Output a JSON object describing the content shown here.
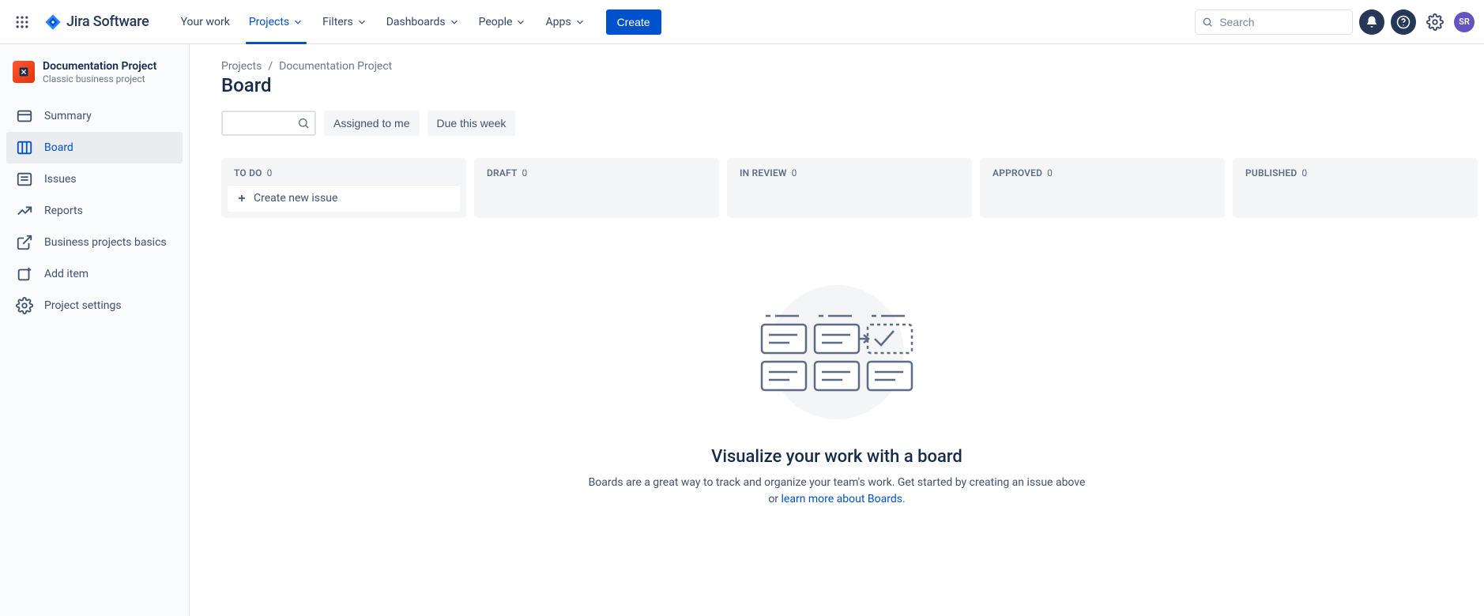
{
  "topnav": {
    "logo_text": "Jira Software",
    "items": [
      {
        "label": "Your work",
        "dropdown": false,
        "active": false
      },
      {
        "label": "Projects",
        "dropdown": true,
        "active": true
      },
      {
        "label": "Filters",
        "dropdown": true,
        "active": false
      },
      {
        "label": "Dashboards",
        "dropdown": true,
        "active": false
      },
      {
        "label": "People",
        "dropdown": true,
        "active": false
      },
      {
        "label": "Apps",
        "dropdown": true,
        "active": false
      }
    ],
    "create_label": "Create",
    "search_placeholder": "Search",
    "avatar_initials": "SR"
  },
  "sidebar": {
    "project_name": "Documentation Project",
    "project_type": "Classic business project",
    "items": [
      {
        "label": "Summary",
        "icon": "card"
      },
      {
        "label": "Board",
        "icon": "board",
        "active": true
      },
      {
        "label": "Issues",
        "icon": "issues"
      },
      {
        "label": "Reports",
        "icon": "reports"
      },
      {
        "label": "Business projects basics",
        "icon": "external"
      },
      {
        "label": "Add item",
        "icon": "add"
      },
      {
        "label": "Project settings",
        "icon": "gear"
      }
    ]
  },
  "main": {
    "breadcrumbs": [
      "Projects",
      "Documentation Project"
    ],
    "title": "Board",
    "filters": {
      "assigned_label": "Assigned to me",
      "due_label": "Due this week"
    },
    "columns": [
      {
        "name": "TO DO",
        "count": 0,
        "create": true
      },
      {
        "name": "DRAFT",
        "count": 0
      },
      {
        "name": "IN REVIEW",
        "count": 0
      },
      {
        "name": "APPROVED",
        "count": 0
      },
      {
        "name": "PUBLISHED",
        "count": 0
      }
    ],
    "create_issue_label": "Create new issue",
    "empty": {
      "title": "Visualize your work with a board",
      "text_before": "Boards are a great way to track and organize your team's work. Get started by creating an issue above or ",
      "link_text": "learn more about Boards",
      "text_after": "."
    }
  }
}
